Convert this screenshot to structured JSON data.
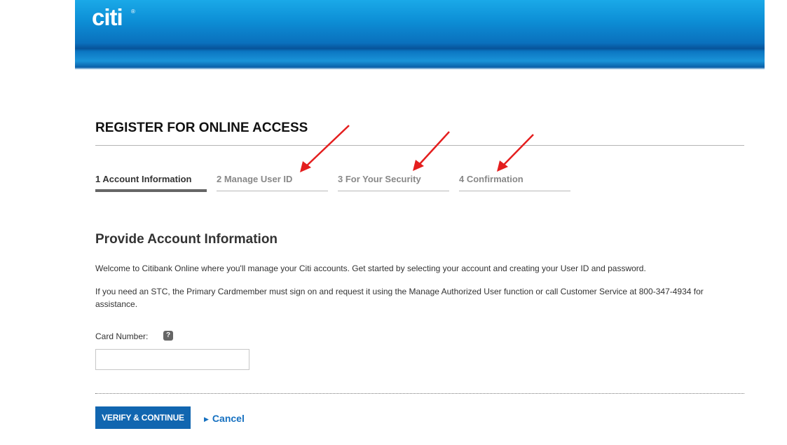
{
  "header": {
    "logo": "citi",
    "logo_mark": "®"
  },
  "page": {
    "title": "REGISTER FOR ONLINE ACCESS"
  },
  "steps": [
    {
      "label": "1 Account Information",
      "active": true
    },
    {
      "label": "2 Manage User ID",
      "active": false
    },
    {
      "label": "3 For Your Security",
      "active": false
    },
    {
      "label": "4 Confirmation",
      "active": false
    }
  ],
  "section": {
    "title": "Provide Account Information",
    "intro": "Welcome to Citibank Online where you'll manage your Citi accounts. Get started by selecting your account and creating your User ID and password.",
    "stc_note": "If you need an STC, the Primary Cardmember must sign on and request it using the Manage Authorized User function or call Customer Service at 800-347-4934 for assistance."
  },
  "form": {
    "card_label": "Card Number:",
    "help_glyph": "?",
    "card_value": "",
    "card_placeholder": ""
  },
  "actions": {
    "verify_label": "VERIFY & CONTINUE",
    "cancel_label": "Cancel",
    "cancel_chevron": "▶"
  },
  "colors": {
    "header_blue": "#0a70bd",
    "button_blue": "#1166b0",
    "link_blue": "#1570c0",
    "annotation_red": "#e41e1e"
  },
  "icons": {
    "help": "help-icon",
    "cancel": "chevron-right-icon",
    "annotation": "red-arrow-icon"
  }
}
